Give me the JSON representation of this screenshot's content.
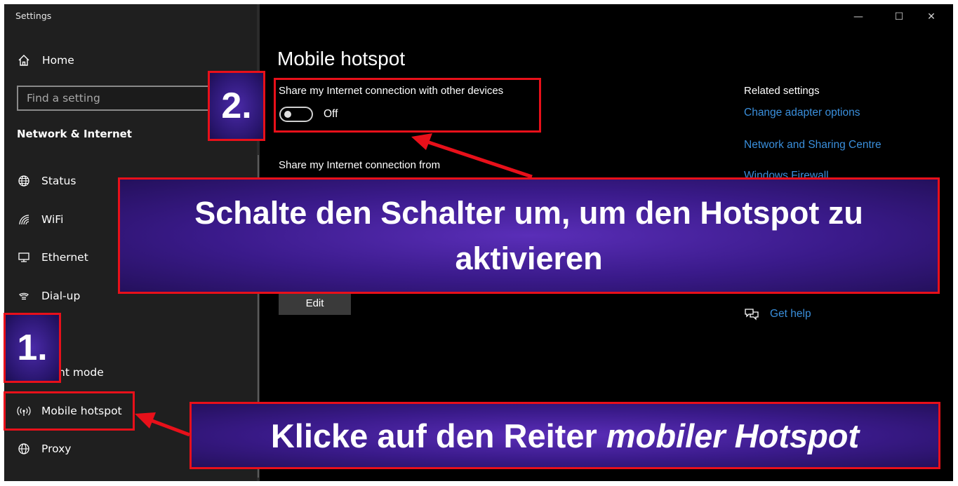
{
  "window": {
    "title": "Settings",
    "controls": {
      "minimize": "—",
      "maximize": "☐",
      "close": "✕"
    }
  },
  "sidebar": {
    "home_label": "Home",
    "search_placeholder": "Find a setting",
    "section_title": "Network & Internet",
    "items": [
      {
        "label": "Status",
        "icon": "globe-icon"
      },
      {
        "label": "WiFi",
        "icon": "wifi-icon"
      },
      {
        "label": "Ethernet",
        "icon": "ethernet-icon"
      },
      {
        "label": "Dial-up",
        "icon": "dialup-icon"
      },
      {
        "label": "N",
        "icon": "vpn-icon"
      },
      {
        "label": "ht mode",
        "icon": "airplane-icon"
      },
      {
        "label": "Mobile hotspot",
        "icon": "hotspot-icon"
      },
      {
        "label": "Proxy",
        "icon": "proxy-globe-icon"
      }
    ]
  },
  "main": {
    "title": "Mobile hotspot",
    "share_label": "Share my Internet connection with other devices",
    "toggle_state": "Off",
    "share_from_label": "Share my Internet connection from",
    "edit_button": "Edit"
  },
  "related": {
    "title": "Related settings",
    "links": [
      "Change adapter options",
      "Network and Sharing Centre",
      "Windows Firewall"
    ],
    "get_help": "Get help"
  },
  "annotations": {
    "step1": "1.",
    "step2": "2.",
    "callout_top": "Schalte den Schalter um, um den Hotspot zu aktivieren",
    "callout_bottom_prefix": "Klicke auf den Reiter ",
    "callout_bottom_emph": "mobiler Hotspot",
    "color": "#e8101a"
  }
}
